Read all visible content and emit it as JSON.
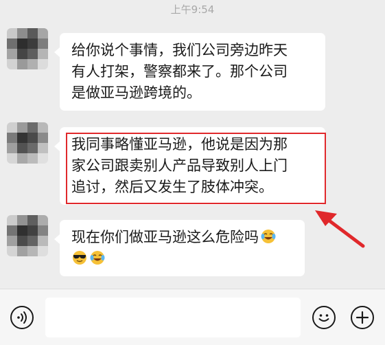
{
  "status": {
    "time": "上午9:54"
  },
  "messages": [
    {
      "lines": [
        "给你说个事情，我们公司旁边昨天",
        "有人打架，警察都来了。那个公司",
        "是做亚马逊跨境的。"
      ]
    },
    {
      "lines": [
        "我同事略懂亚马逊，他说是因为那",
        "家公司跟卖别人产品导致别人上门",
        "追讨，然后又发生了肢体冲突。"
      ]
    },
    {
      "lines": [
        "现在你们做亚马逊这么危险吗"
      ],
      "emojis_after_line1": [
        "face-with-tears-of-joy-icon"
      ],
      "emojis_line2": [
        "smiling-face-with-sunglasses-icon",
        "face-with-tears-of-joy-icon"
      ]
    }
  ],
  "colors": {
    "highlight": "#e0282b",
    "bubble": "#ffffff",
    "background": "#ededed"
  },
  "input_bar": {
    "value": "",
    "voice_icon": "voice-input-icon",
    "emoji_icon": "emoji-picker-icon",
    "more_icon": "more-plus-icon"
  }
}
